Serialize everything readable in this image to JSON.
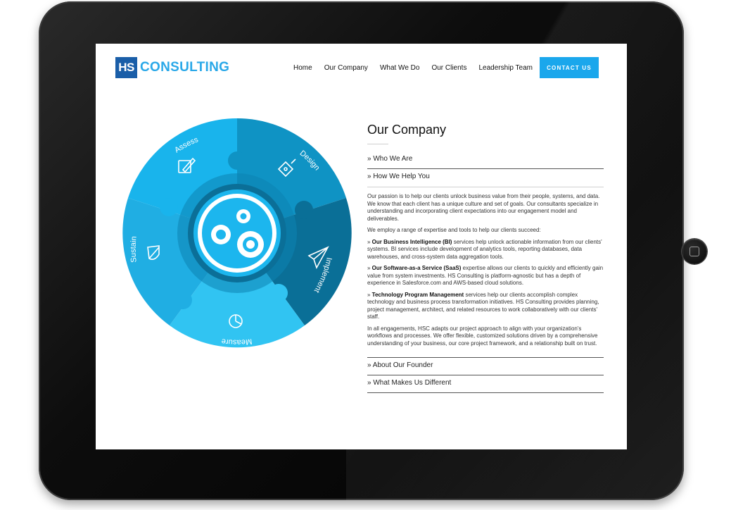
{
  "header": {
    "logo_hs": "HS",
    "logo_text": "CONSULTING",
    "nav": [
      "Home",
      "Our Company",
      "What We Do",
      "Our Clients",
      "Leadership Team"
    ],
    "contact_label": "CONTACT US"
  },
  "wheel": {
    "segments": [
      "Assess",
      "Design",
      "Implement",
      "Measure",
      "Sustain"
    ],
    "icons": [
      "pencil-icon",
      "pen-nib-icon",
      "paper-plane-icon",
      "pie-chart-icon",
      "shield-icon"
    ]
  },
  "main": {
    "title": "Our Company",
    "accordion": [
      {
        "label": "» Who We Are"
      },
      {
        "label": "» How We Help You"
      },
      {
        "label": "» About Our Founder"
      },
      {
        "label": "» What Makes Us Different"
      }
    ],
    "body": {
      "p1": "Our passion is to help our clients unlock business value from their people, systems, and data. We know that each client has a unique culture and set of goals. Our consultants specialize in understanding and incorporating client expectations into our engagement model and deliverables.",
      "p2": "We employ a range of expertise and tools to help our clients succeed:",
      "bi_prefix": "» ",
      "bi_title": "Our Business Intelligence (BI)",
      "bi_text": " services help unlock actionable information from our clients' systems. BI services include development of analytics tools, reporting databases, data warehouses, and cross-system data aggregation tools.",
      "saas_prefix": "» ",
      "saas_title": "Our Software-as-a Service (SaaS)",
      "saas_text": " expertise allows our clients to quickly and efficiently gain value from system investments. HS Consulting is platform-agnostic but has a depth of experience in Salesforce.com and AWS-based cloud solutions.",
      "tpm_prefix": "» ",
      "tpm_title": "Technology Program Management",
      "tpm_text": " services help our clients accomplish complex technology and business process transformation initiatives. HS Consulting provides planning, project management, architect, and related resources to work collaboratively with our clients' staff.",
      "p_last": "In all engagements, HSC adapts our project approach to align with your organization's workflows and processes. We offer flexible, customized solutions driven by a comprehensive understanding of your business, our core project framework, and a relationship built on trust."
    }
  },
  "colors": {
    "brand_dark": "#1a5ea8",
    "brand_light": "#2aa8e8",
    "contact_bg": "#1aa7ec"
  }
}
